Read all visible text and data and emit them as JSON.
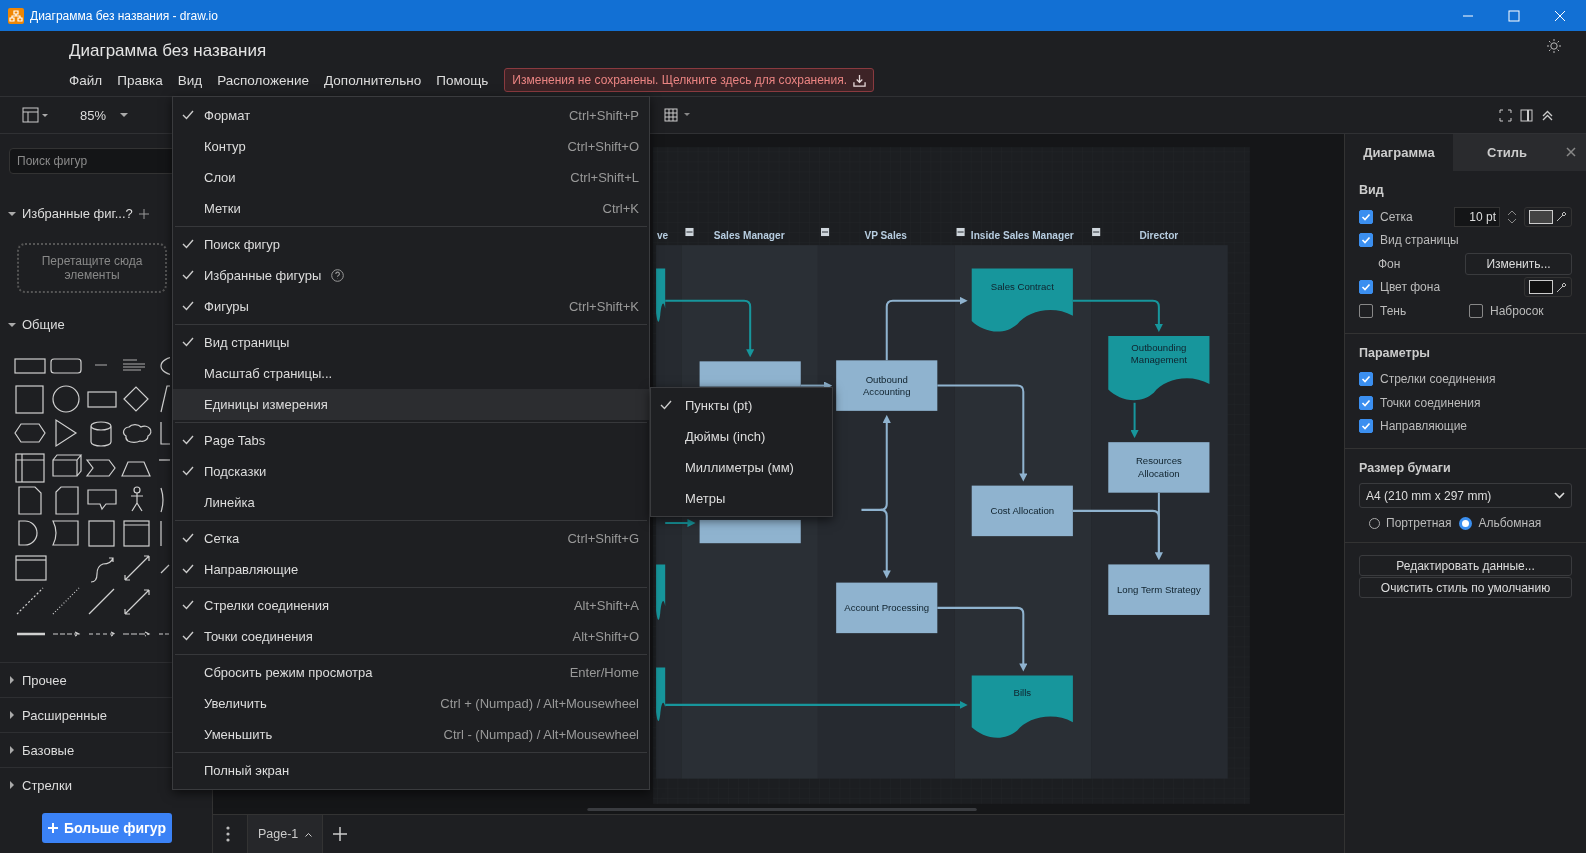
{
  "window": {
    "title": "Диаграмма без названия - draw.io"
  },
  "document": {
    "title": "Диаграмма без названия"
  },
  "menu_bar": [
    "Файл",
    "Правка",
    "Вид",
    "Расположение",
    "Дополнительно",
    "Помощь"
  ],
  "save_notice": "Изменения не сохранены. Щелкните здесь для сохранения.",
  "toolbar": {
    "zoom": "85%"
  },
  "sidebar": {
    "search": {
      "placeholder": "Поиск фигур"
    },
    "favorites": {
      "title": "Избранные фиг...?",
      "dropzone": "Перетащите сюда элементы"
    },
    "sections": [
      {
        "title": "Общие",
        "expanded": true
      },
      {
        "title": "Прочее",
        "expanded": false
      },
      {
        "title": "Расширенные",
        "expanded": false
      },
      {
        "title": "Базовые",
        "expanded": false
      },
      {
        "title": "Стрелки",
        "expanded": false
      }
    ],
    "more_button": "Больше фигур"
  },
  "view_menu": [
    [
      {
        "label": "Формат",
        "shortcut": "Ctrl+Shift+P",
        "checked": true,
        "selected": false
      },
      {
        "label": "Контур",
        "shortcut": "Ctrl+Shift+O",
        "checked": false,
        "selected": false
      },
      {
        "label": "Слои",
        "shortcut": "Ctrl+Shift+L",
        "checked": false,
        "selected": false
      },
      {
        "label": "Метки",
        "shortcut": "Ctrl+K",
        "checked": false,
        "selected": false
      }
    ],
    [
      {
        "label": "Поиск фигур",
        "checked": true,
        "selected": false
      },
      {
        "label": "Избранные фигуры",
        "checked": true,
        "selected": false,
        "help": true
      },
      {
        "label": "Фигуры",
        "shortcut": "Ctrl+Shift+K",
        "checked": true,
        "selected": false
      }
    ],
    [
      {
        "label": "Вид страницы",
        "checked": true,
        "selected": false
      },
      {
        "label": "Масштаб страницы...",
        "checked": false,
        "selected": false
      },
      {
        "label": "Единицы измерения",
        "checked": false,
        "selected": true
      }
    ],
    [
      {
        "label": "Page Tabs",
        "checked": true,
        "selected": false
      },
      {
        "label": "Подсказки",
        "checked": true,
        "selected": false
      },
      {
        "label": "Линейка",
        "checked": false,
        "selected": false
      }
    ],
    [
      {
        "label": "Сетка",
        "shortcut": "Ctrl+Shift+G",
        "checked": true,
        "selected": false
      },
      {
        "label": "Направляющие",
        "checked": true,
        "selected": false
      }
    ],
    [
      {
        "label": "Стрелки соединения",
        "shortcut": "Alt+Shift+A",
        "checked": true,
        "selected": false
      },
      {
        "label": "Точки соединения",
        "shortcut": "Alt+Shift+O",
        "checked": true,
        "selected": false
      }
    ],
    [
      {
        "label": "Сбросить режим просмотра",
        "shortcut": "Enter/Home",
        "checked": false,
        "selected": false
      },
      {
        "label": "Увеличить",
        "shortcut": "Ctrl + (Numpad) / Alt+Mousewheel",
        "checked": false,
        "selected": false
      },
      {
        "label": "Уменьшить",
        "shortcut": "Ctrl - (Numpad) / Alt+Mousewheel",
        "checked": false,
        "selected": false
      }
    ],
    [
      {
        "label": "Полный экран",
        "checked": false,
        "selected": false
      }
    ]
  ],
  "units_submenu": [
    {
      "label": "Пункты (pt)",
      "checked": true
    },
    {
      "label": "Дюймы (inch)",
      "checked": false
    },
    {
      "label": "Миллиметры (мм)",
      "checked": false
    },
    {
      "label": "Метры",
      "checked": false
    }
  ],
  "diagram": {
    "lanes": [
      {
        "title": "ve"
      },
      {
        "title": "Sales Manager"
      },
      {
        "title": "VP Sales"
      },
      {
        "title": "Inside Sales Manager"
      },
      {
        "title": "Director"
      }
    ],
    "nodes": [
      {
        "kind": "document"
      },
      {
        "kind": "process"
      },
      {
        "kind": "process"
      },
      {
        "kind": "document"
      },
      {
        "kind": "document"
      },
      {
        "kind": "process",
        "label": "Outbound Accounting"
      },
      {
        "kind": "process",
        "label": "Account Processing"
      },
      {
        "kind": "document",
        "label": "Sales Contract"
      },
      {
        "kind": "process",
        "label": "Cost Allocation"
      },
      {
        "kind": "document",
        "label": "Bills"
      },
      {
        "kind": "document",
        "label": "Outbounding Management"
      },
      {
        "kind": "process",
        "label": "Resources Allocation"
      },
      {
        "kind": "process",
        "label": "Long Term Strategy"
      }
    ]
  },
  "format_panel": {
    "tabs": [
      {
        "label": "Диаграмма",
        "selected": true
      },
      {
        "label": "Стиль",
        "selected": false
      }
    ],
    "view": {
      "title": "Вид",
      "grid": {
        "label": "Сетка",
        "checked": true,
        "size": "10 pt"
      },
      "page_view": {
        "label": "Вид страницы",
        "checked": true
      },
      "background": {
        "label": "Фон",
        "button": "Изменить..."
      },
      "background_color": {
        "label": "Цвет фона",
        "checked": true
      },
      "shadow": {
        "label": "Тень",
        "checked": false
      },
      "sketch": {
        "label": "Набросок",
        "checked": false
      }
    },
    "options": {
      "title": "Параметры",
      "items": [
        {
          "label": "Стрелки соединения",
          "checked": true
        },
        {
          "label": "Точки соединения",
          "checked": true
        },
        {
          "label": "Направляющие",
          "checked": true
        }
      ]
    },
    "paper": {
      "title": "Размер бумаги",
      "size": "A4 (210 mm x 297 mm)",
      "orientations": [
        {
          "label": "Портретная",
          "selected": false
        },
        {
          "label": "Альбомная",
          "selected": true
        }
      ]
    },
    "buttons": [
      "Редактировать данные...",
      "Очистить стиль по умолчанию"
    ]
  },
  "page_tabs": [
    {
      "label": "Page-1",
      "selected": true
    }
  ]
}
